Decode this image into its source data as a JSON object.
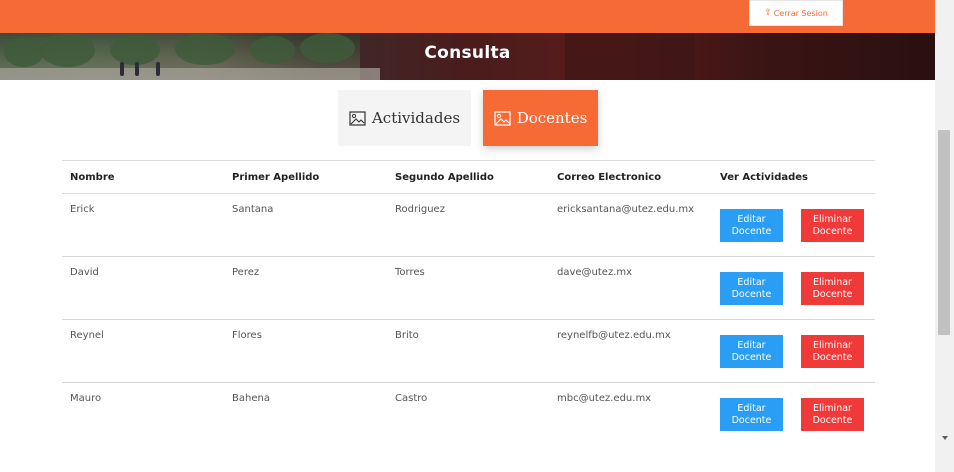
{
  "header": {
    "logout_label": "Cerrar Sesion",
    "logout_icon": "logout-icon"
  },
  "banner": {
    "title": "Consulta"
  },
  "tabs": [
    {
      "label": "Actividades",
      "icon": "image-icon",
      "active": false
    },
    {
      "label": "Docentes",
      "icon": "image-icon",
      "active": true
    }
  ],
  "table": {
    "headers": [
      "Nombre",
      "Primer Apellido",
      "Segundo Apellido",
      "Correo Electronico",
      "Ver Actividades"
    ],
    "rows": [
      {
        "nombre": "Erick",
        "primer_apellido": "Santana",
        "segundo_apellido": "Rodriguez",
        "correo": "ericksantana@utez.edu.mx"
      },
      {
        "nombre": "David",
        "primer_apellido": "Perez",
        "segundo_apellido": "Torres",
        "correo": "dave@utez.mx"
      },
      {
        "nombre": "Reynel",
        "primer_apellido": "Flores",
        "segundo_apellido": "Brito",
        "correo": "reynelfb@utez.edu.mx"
      },
      {
        "nombre": "Mauro",
        "primer_apellido": "Bahena",
        "segundo_apellido": "Castro",
        "correo": "mbc@utez.edu.mx"
      }
    ],
    "edit_label": "Editar\nDocente",
    "delete_label": "Eliminar\nDocente"
  },
  "colors": {
    "accent": "#f56a35",
    "edit": "#2a9df4",
    "delete": "#f03a3a"
  }
}
